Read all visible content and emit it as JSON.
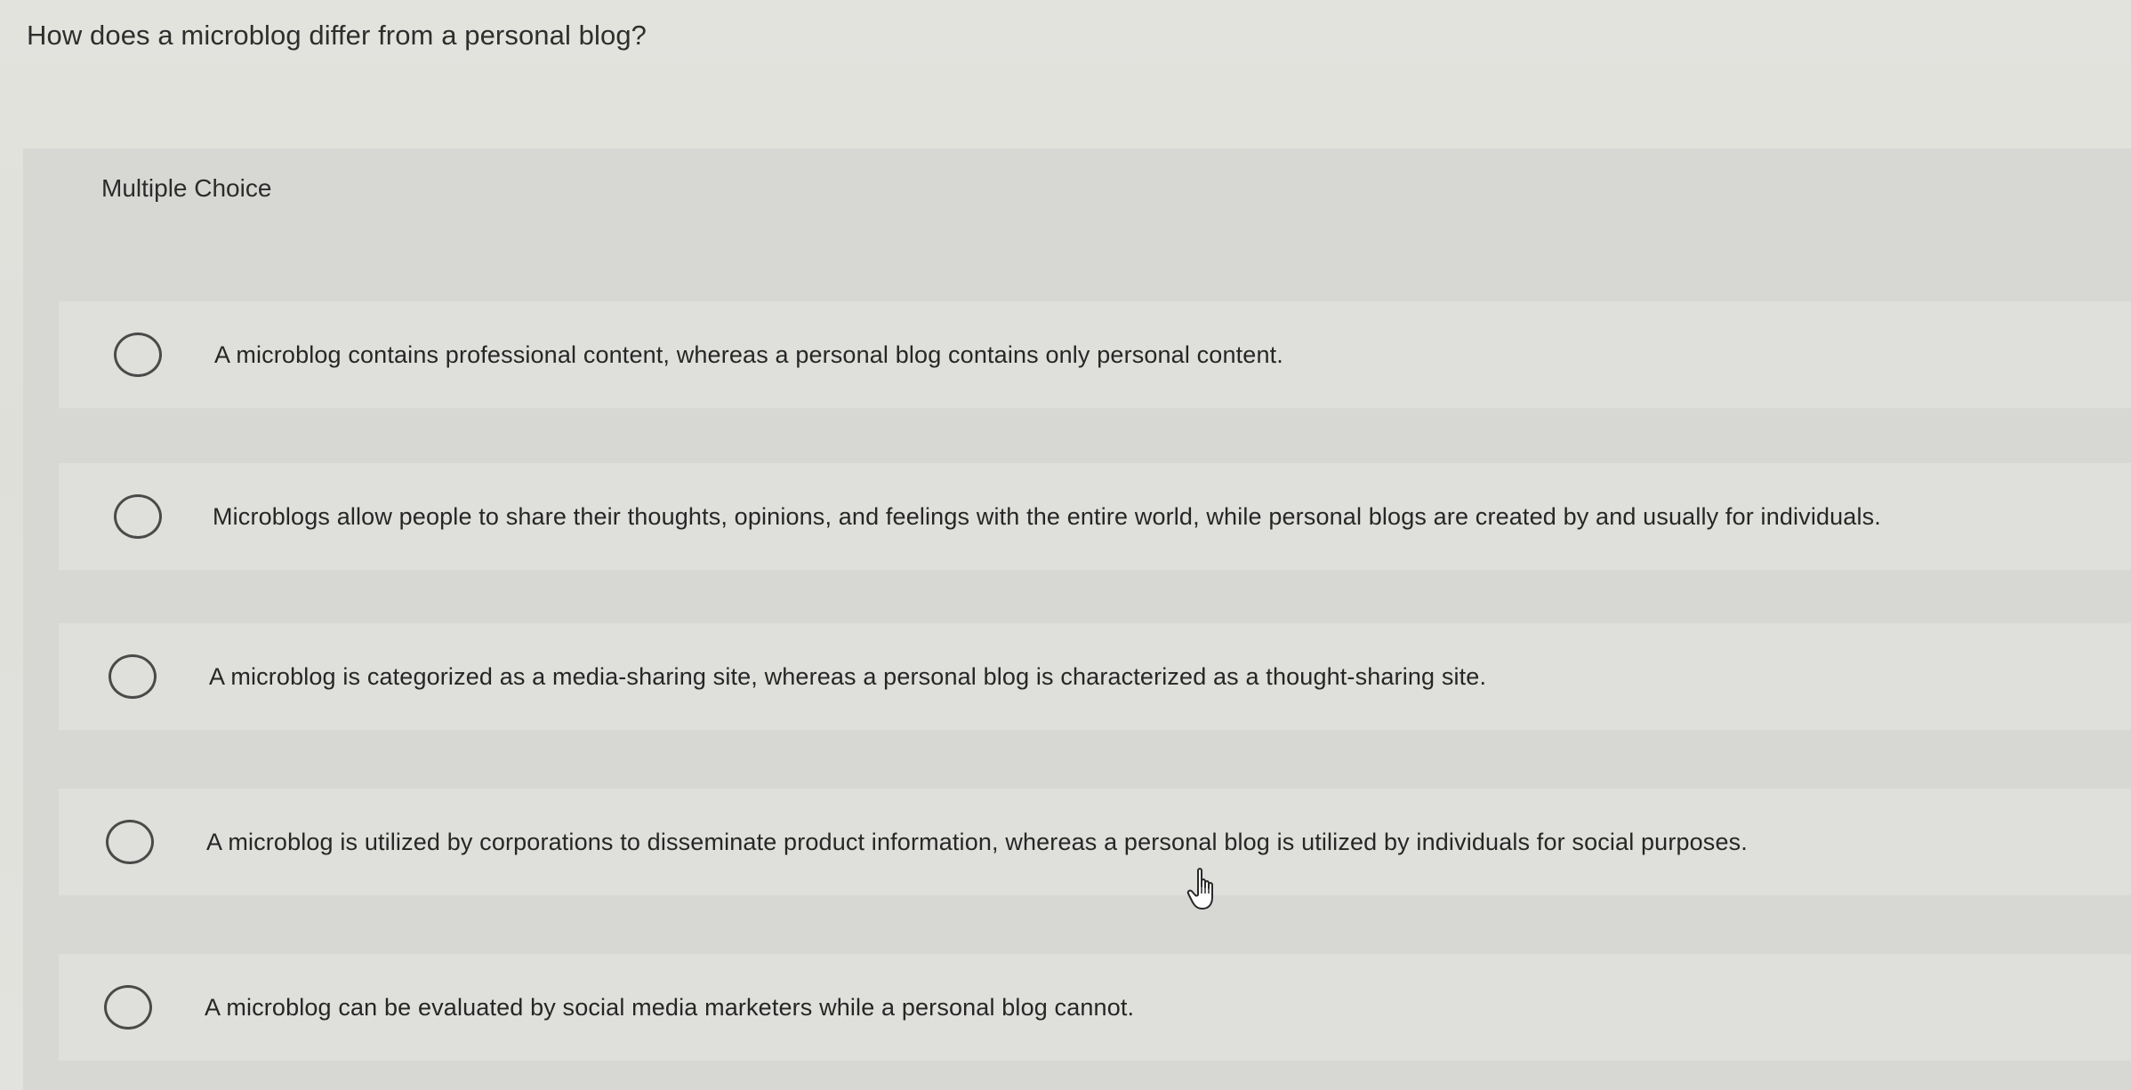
{
  "question": {
    "text": "How does a microblog differ from a personal blog?"
  },
  "quiz": {
    "type_label": "Multiple Choice",
    "options": [
      {
        "label": "A microblog contains professional content, whereas a personal blog contains only personal content."
      },
      {
        "label": "Microblogs allow people to share their thoughts, opinions, and feelings with the entire world, while personal blogs are created by and usually for individuals."
      },
      {
        "label": "A microblog is categorized as a media-sharing site, whereas a personal blog is characterized as a thought-sharing site."
      },
      {
        "label": "A microblog is utilized by corporations to disseminate product information, whereas a personal blog is utilized by individuals for social purposes."
      },
      {
        "label": "A microblog can be evaluated by social media marketers while a personal blog cannot."
      }
    ]
  },
  "cursor": {
    "icon": "hand-pointer-icon"
  }
}
